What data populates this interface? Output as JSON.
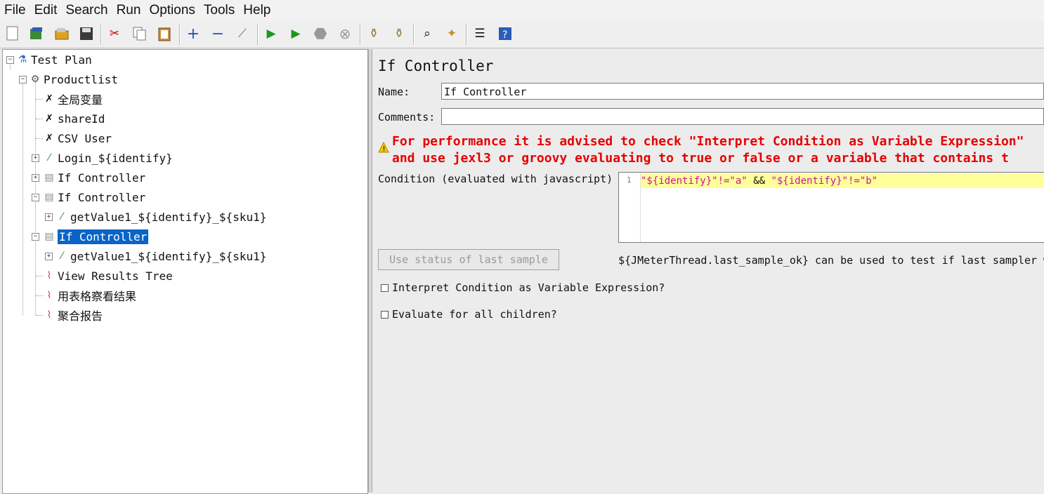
{
  "menu": [
    "File",
    "Edit",
    "Search",
    "Run",
    "Options",
    "Tools",
    "Help"
  ],
  "toolbar_icons": [
    "new-icon",
    "templates-icon",
    "open-icon",
    "save-icon",
    "cut-icon",
    "copy-icon",
    "paste-icon",
    "expand-icon",
    "collapse-icon",
    "toggle-icon",
    "start-icon",
    "start-no-pause-icon",
    "stop-icon",
    "shutdown-icon",
    "clear-icon",
    "clear-all-icon",
    "search-icon",
    "reset-search-icon",
    "function-helper-icon",
    "help-icon"
  ],
  "tree": {
    "test_plan": "Test Plan",
    "thread_group": "Productlist",
    "items": [
      "全局变量",
      "shareId",
      "CSV User",
      "Login_${identify}",
      "If Controller",
      "If Controller",
      "getValue1_${identify}_${sku1}",
      "If Controller",
      "getValue1_${identify}_${sku1}",
      "View Results Tree",
      "用表格察看结果",
      "聚合报告"
    ]
  },
  "panel": {
    "title": "If Controller",
    "name_label": "Name:",
    "name_value": "If Controller",
    "comments_label": "Comments:",
    "comments_value": "",
    "warning_line1": "For performance it is advised to check \"Interpret Condition as Variable Expression\"",
    "warning_line2": "and use   jexl3 or   groovy evaluating to true or false or a variable that contains t",
    "condition_label": "Condition (evaluated with javascript)",
    "line_number": "1",
    "code_part1": "\"${identify}\"!=\"a\"",
    "code_part2": " && ",
    "code_part3": "\"${identify}\"!=\"b\"",
    "use_status_button": "Use status of last sample",
    "hint_text": "${JMeterThread.last_sample_ok} can be used to test if last sampler w",
    "checkbox1": "Interpret Condition as Variable Expression?",
    "checkbox2": "Evaluate for all children?"
  }
}
